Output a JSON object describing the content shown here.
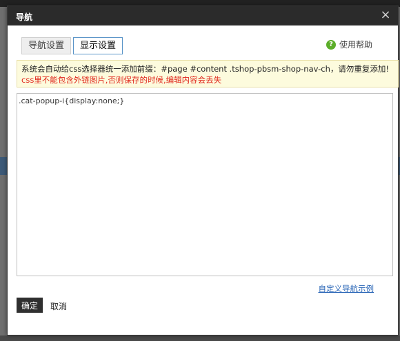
{
  "dialog": {
    "title": "导航",
    "close_glyph": "×"
  },
  "tabs": [
    {
      "label": "导航设置",
      "active": false
    },
    {
      "label": "显示设置",
      "active": true
    }
  ],
  "help": {
    "icon": "question-icon",
    "icon_glyph": "?",
    "label": "使用帮助"
  },
  "notice": {
    "line1": "系统会自动给css选择器统一添加前缀：#page #content .tshop-pbsm-shop-nav-ch，请勿重复添加!",
    "line2": "css里不能包含外链图片,否则保存的时候,编辑内容会丢失"
  },
  "editor": {
    "value": ".cat-popup-i{display:none;}"
  },
  "footer": {
    "example_link": "自定义导航示例",
    "ok_label": "确定",
    "cancel_label": "取消"
  },
  "colors": {
    "titlebar": "#2b2b2b",
    "warning_text": "#e0261b",
    "link": "#2a66b7",
    "help_icon": "#5cae2a"
  }
}
